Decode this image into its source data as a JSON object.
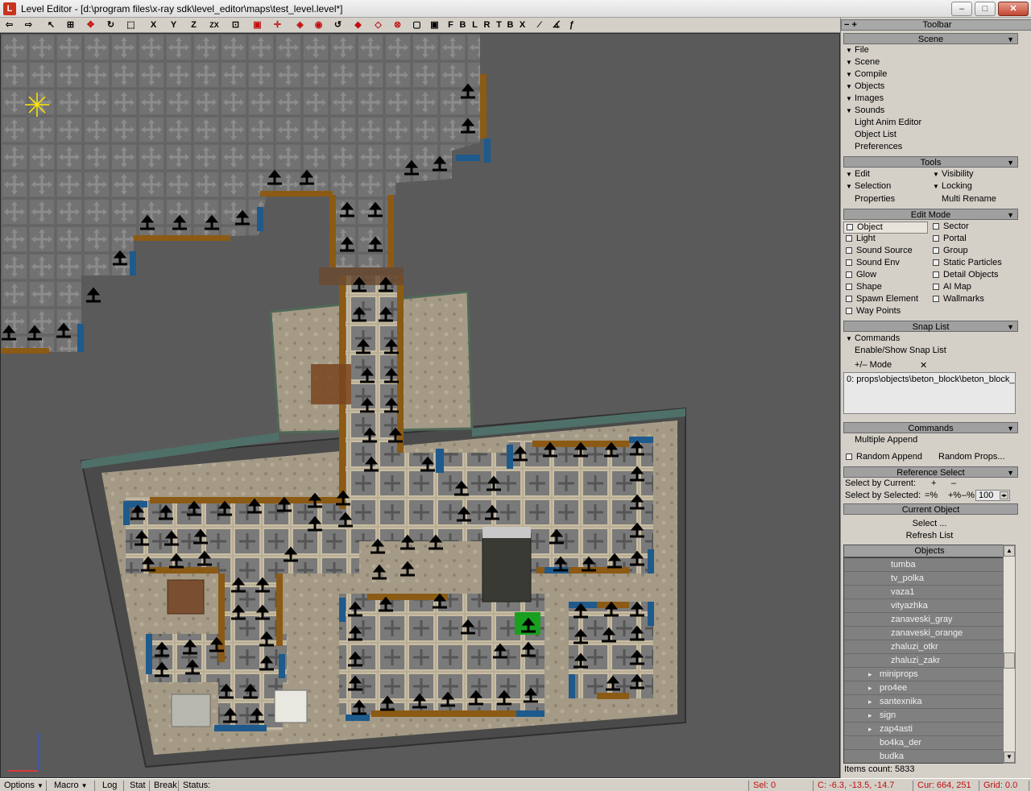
{
  "window": {
    "title": "Level Editor - [d:\\program files\\x-ray sdk\\level_editor\\maps\\test_level.level*]",
    "icon_letter": "L",
    "min": "–",
    "max": "□",
    "close": "✕"
  },
  "toolbar": {
    "axis_buttons": [
      "X",
      "Y",
      "Z",
      "ZX"
    ],
    "view_buttons": [
      "F",
      "B",
      "L",
      "R",
      "T",
      "B",
      "X"
    ]
  },
  "panel": {
    "title": "Toolbar",
    "title_left": "− +",
    "scene": {
      "header": "Scene",
      "menus": [
        "File",
        "Scene",
        "Compile",
        "Objects",
        "Images",
        "Sounds"
      ],
      "links": [
        "Light Anim Editor",
        "Object List",
        "Preferences"
      ]
    },
    "tools": {
      "header": "Tools",
      "left": [
        "Edit",
        "Selection",
        "Properties"
      ],
      "right": [
        "Visibility",
        "Locking",
        "Multi Rename"
      ]
    },
    "edit_mode": {
      "header": "Edit Mode",
      "left": [
        "Object",
        "Light",
        "Sound Source",
        "Sound Env",
        "Glow",
        "Shape",
        "Spawn Element",
        "Way Points"
      ],
      "right": [
        "Sector",
        "Portal",
        "Group",
        "Static Particles",
        "Detail Objects",
        "AI Map",
        "Wallmarks"
      ]
    },
    "snap_list": {
      "header": "Snap List",
      "commands": "Commands",
      "enable": "Enable/Show Snap List",
      "mode_label": "+/– Mode",
      "mode_x": "✕",
      "entry": "0: props\\objects\\beton_block\\beton_block_"
    },
    "commands": {
      "header": "Commands",
      "multiple_append": "Multiple Append",
      "random_append": "Random Append",
      "random_props": "Random Props..."
    },
    "reference_select": {
      "header": "Reference Select",
      "by_current": "Select by Current:",
      "by_selected": "Select by Selected:",
      "plus": "+",
      "minus": "–",
      "eq_pct": "=%",
      "plus_pct": "+%",
      "minus_pct": "–%",
      "value": "100"
    },
    "current_object": {
      "header": "Current Object",
      "select": "Select ...",
      "refresh": "Refresh List"
    },
    "objects": {
      "header": "Objects",
      "rows": [
        {
          "label": "tumba",
          "expandable": false,
          "indent": 2
        },
        {
          "label": "tv_polka",
          "expandable": false,
          "indent": 2
        },
        {
          "label": "vaza1",
          "expandable": false,
          "indent": 2
        },
        {
          "label": "vityazhka",
          "expandable": false,
          "indent": 2
        },
        {
          "label": "zanaveski_gray",
          "expandable": false,
          "indent": 2
        },
        {
          "label": "zanaveski_orange",
          "expandable": false,
          "indent": 2
        },
        {
          "label": "zhaluzi_otkr",
          "expandable": false,
          "indent": 2
        },
        {
          "label": "zhaluzi_zakr",
          "expandable": false,
          "indent": 2
        },
        {
          "label": "miniprops",
          "expandable": true,
          "indent": 1
        },
        {
          "label": "pro4ee",
          "expandable": true,
          "indent": 1
        },
        {
          "label": "santexnika",
          "expandable": true,
          "indent": 1
        },
        {
          "label": "sign",
          "expandable": true,
          "indent": 1
        },
        {
          "label": "zap4asti",
          "expandable": true,
          "indent": 1
        },
        {
          "label": "bo4ka_der",
          "expandable": false,
          "indent": 1
        },
        {
          "label": "budka",
          "expandable": false,
          "indent": 1
        }
      ],
      "items_count": "Items count: 5833"
    }
  },
  "statusbar": {
    "options": "Options",
    "macro": "Macro",
    "log": "Log",
    "stat": "Stat",
    "break": "Break",
    "status": "Status:",
    "sel": "Sel: 0",
    "coords": "C: -6.3, -13.5, -14.7",
    "cur": "Cur: 664, 251",
    "grid": "Grid: 0.0"
  },
  "colors": {
    "panel_bg": "#d4d0c8",
    "viewport_bg": "#5a5a5a",
    "status_red": "#c01010",
    "tile_brown": "#8b5a14",
    "tile_blue": "#1e5a8c"
  }
}
